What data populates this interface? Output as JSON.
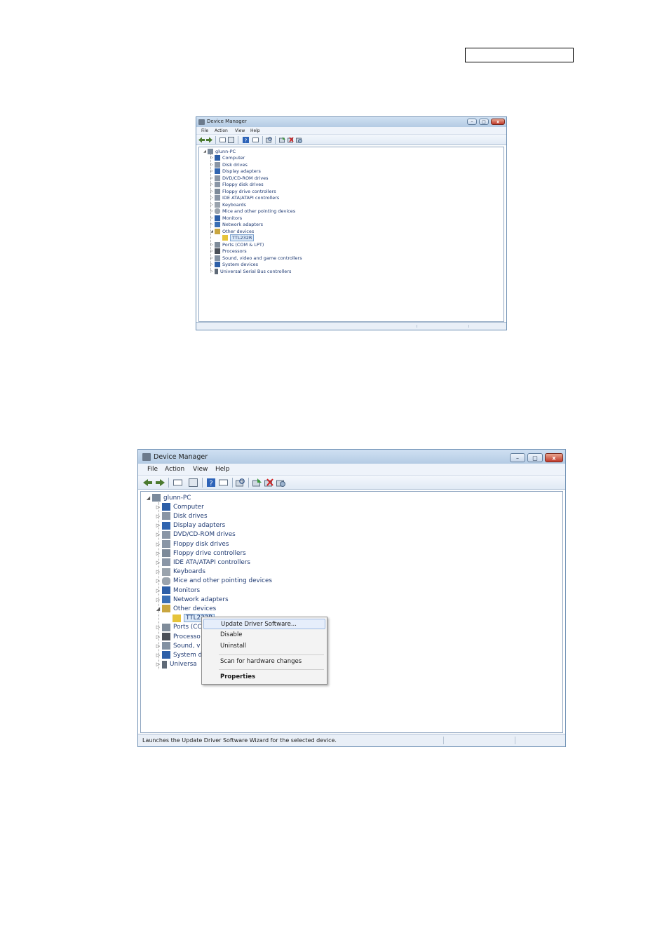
{
  "colors": {
    "title_gradient": [
      "#cfe0f2",
      "#b4cbe4"
    ],
    "tree_text": "#1f3a72",
    "selection": "#dbe9f8",
    "close_button": "#c0392b"
  },
  "window": {
    "title": "Device Manager",
    "menu": [
      "File",
      "Action",
      "View",
      "Help"
    ],
    "controls": {
      "minimize": "–",
      "maximize": "□",
      "close": "x"
    },
    "toolbar_icons": [
      "back-arrow-icon",
      "forward-arrow-icon",
      "properties-icon",
      "show-hide-console-tree-icon",
      "help-icon",
      "show-action-pane-icon",
      "scan-hardware-icon",
      "update-driver-icon",
      "uninstall-icon",
      "disable-device-icon"
    ]
  },
  "tree": {
    "root": "glunn-PC",
    "items": [
      "Computer",
      "Disk drives",
      "Display adapters",
      "DVD/CD-ROM drives",
      "Floppy disk drives",
      "Floppy drive controllers",
      "IDE ATA/ATAPI controllers",
      "Keyboards",
      "Mice and other pointing devices",
      "Monitors",
      "Network adapters",
      "Other devices",
      "TTL232R",
      "Ports (COM & LPT)",
      "Processors",
      "Sound, video and game controllers",
      "System devices",
      "Universal Serial Bus controllers"
    ]
  },
  "screenshot2": {
    "truncated_items": [
      "TTL232R",
      "Ports (CC",
      "Processo",
      "Sound, v",
      "System d",
      "Universa"
    ],
    "context_menu": [
      "Update Driver Software...",
      "Disable",
      "Uninstall",
      "Scan for hardware changes",
      "Properties"
    ],
    "status_text": "Launches the Update Driver Software Wizard for the selected device."
  }
}
